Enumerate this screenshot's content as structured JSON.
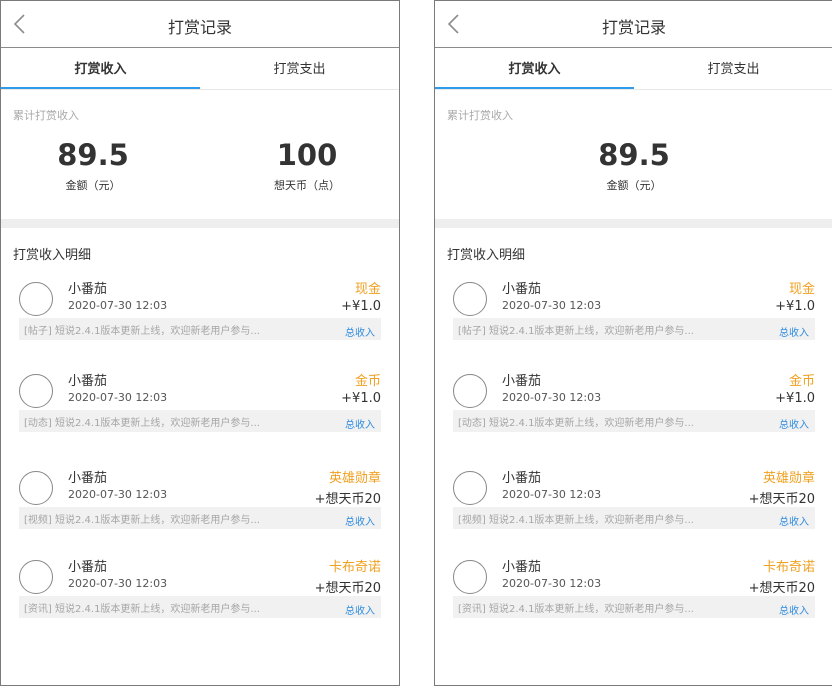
{
  "screens": [
    {
      "header": {
        "title": "打赏记录"
      },
      "tabs": [
        {
          "label": "打赏收入"
        },
        {
          "label": "打赏支出"
        }
      ],
      "summary": {
        "label": "累计打赏收入",
        "stats": [
          {
            "value": "89.5",
            "label": "金额（元）"
          },
          {
            "value": "100",
            "label": "想天币（点）"
          }
        ]
      },
      "details": {
        "title": "打赏收入明细",
        "records": [
          {
            "name": "小番茄",
            "time": "2020-07-30 12:03",
            "type": "现金",
            "amount": "+¥1.0",
            "desc": "[帖子] 短说2.4.1版本更新上线，欢迎新老用户参与...",
            "link": "总收入"
          },
          {
            "name": "小番茄",
            "time": "2020-07-30 12:03",
            "type": "金币",
            "amount": "+¥1.0",
            "desc": "[动态] 短说2.4.1版本更新上线，欢迎新老用户参与...",
            "link": "总收入"
          },
          {
            "name": "小番茄",
            "time": "2020-07-30 12:03",
            "type": "英雄勋章",
            "amount": "+想天币20",
            "desc": "[视频] 短说2.4.1版本更新上线，欢迎新老用户参与...",
            "link": "总收入"
          },
          {
            "name": "小番茄",
            "time": "2020-07-30 12:03",
            "type": "卡布奇诺",
            "amount": "+想天币20",
            "desc": "[资讯] 短说2.4.1版本更新上线，欢迎新老用户参与...",
            "link": "总收入"
          }
        ]
      }
    },
    {
      "header": {
        "title": "打赏记录"
      },
      "tabs": [
        {
          "label": "打赏收入"
        },
        {
          "label": "打赏支出"
        }
      ],
      "summary": {
        "label": "累计打赏收入",
        "stats": [
          {
            "value": "89.5",
            "label": "金额（元）"
          }
        ]
      },
      "details": {
        "title": "打赏收入明细",
        "records": [
          {
            "name": "小番茄",
            "time": "2020-07-30 12:03",
            "type": "现金",
            "amount": "+¥1.0",
            "desc": "[帖子] 短说2.4.1版本更新上线，欢迎新老用户参与...",
            "link": "总收入"
          },
          {
            "name": "小番茄",
            "time": "2020-07-30 12:03",
            "type": "金币",
            "amount": "+¥1.0",
            "desc": "[动态] 短说2.4.1版本更新上线，欢迎新老用户参与...",
            "link": "总收入"
          },
          {
            "name": "小番茄",
            "time": "2020-07-30 12:03",
            "type": "英雄勋章",
            "amount": "+想天币20",
            "desc": "[视频] 短说2.4.1版本更新上线，欢迎新老用户参与...",
            "link": "总收入"
          },
          {
            "name": "小番茄",
            "time": "2020-07-30 12:03",
            "type": "卡布奇诺",
            "amount": "+想天币20",
            "desc": "[资讯] 短说2.4.1版本更新上线，欢迎新老用户参与...",
            "link": "总收入"
          }
        ]
      }
    }
  ],
  "colors": {
    "accent": "#2f9bec",
    "reward_type": "#f0a020",
    "link": "#2f8ce0"
  },
  "icons": {
    "back": "chevron-left-icon"
  }
}
